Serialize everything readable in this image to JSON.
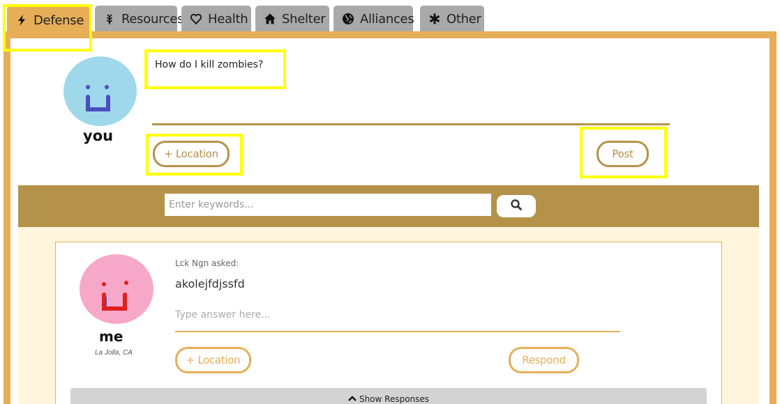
{
  "tabs": [
    {
      "label": "Defense",
      "icon": "lightning-icon",
      "active": true
    },
    {
      "label": "Resources",
      "icon": "wheat-icon",
      "active": false
    },
    {
      "label": "Health",
      "icon": "heart-icon",
      "active": false
    },
    {
      "label": "Shelter",
      "icon": "home-icon",
      "active": false
    },
    {
      "label": "Alliances",
      "icon": "globe-icon",
      "active": false
    },
    {
      "label": "Other",
      "icon": "asterisk-icon",
      "active": false
    }
  ],
  "composer": {
    "user_name": "you",
    "question_value": "How do I kill zombies?",
    "location_button": "+ Location",
    "post_button": "Post"
  },
  "search": {
    "placeholder": "Enter keywords...",
    "button_icon": "search-icon"
  },
  "post": {
    "asker": "Lck Ngn asked:",
    "question": "akolejfdjssfd",
    "answer_placeholder": "Type answer here...",
    "user_name": "me",
    "user_location": "La Jolla, CA",
    "location_button": "+ Location",
    "respond_button": "Respond",
    "show_responses": "Show Responses"
  },
  "colors": {
    "accent": "#e6ae57",
    "dark_accent": "#b5924a",
    "tab_inactive": "#a9a9a9",
    "highlight": "#ffff00",
    "avatar_blue": "#9fd8ea",
    "avatar_pink": "#f7a8c8",
    "feed_bg": "#fff6dd"
  }
}
